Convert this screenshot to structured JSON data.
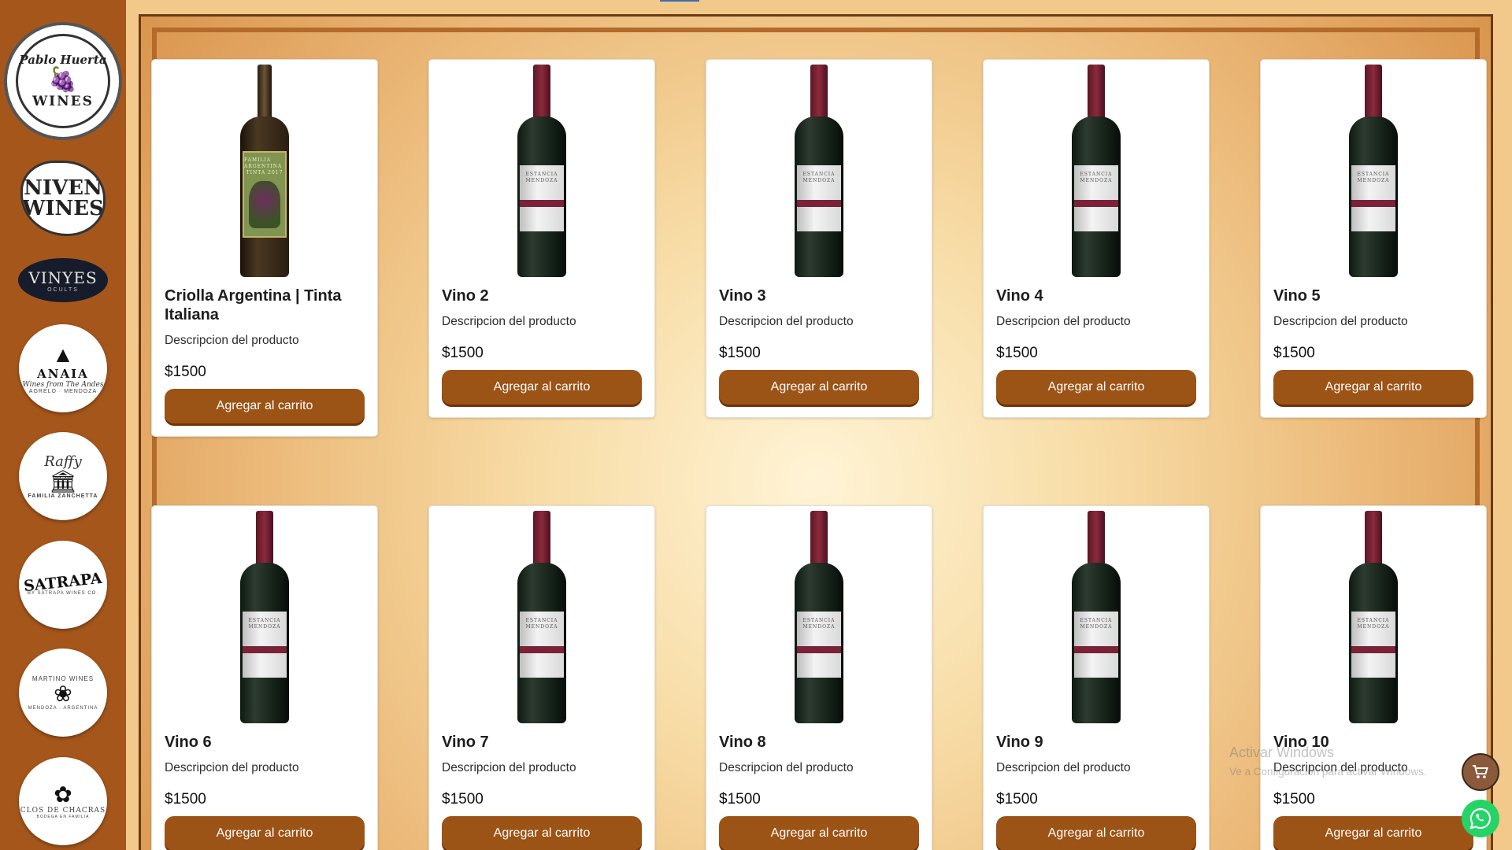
{
  "sidebar": {
    "brands": [
      {
        "name": "Pablo Huerta Wines",
        "top": "Pablo Huerta",
        "bottom": "WINES"
      },
      {
        "name": "Niven Wines",
        "lines": [
          "NIVEN",
          "WINES"
        ]
      },
      {
        "name": "Vinyes Ocults",
        "big": "VINYES",
        "small": "OCULTS"
      },
      {
        "name": "Anaia",
        "title": "ANAIA",
        "sub": "Wines from The Andes",
        "tiny": "AGRELO · MENDOZA"
      },
      {
        "name": "Familia Zanchetta",
        "sub": "Raffy",
        "tiny": "FAMILIA ZANCHETTA"
      },
      {
        "name": "Satrapa",
        "title": "SATRAPA",
        "tiny": "BY SATRAPA WINES CO."
      },
      {
        "name": "Martino Wines",
        "title": "MARTINO WINES",
        "tiny": "MENDOZA · ARGENTINA"
      },
      {
        "name": "Clos de Chacras",
        "title": "CLOS DE CHACRAS",
        "tiny": "BODEGA EN FAMILIA"
      }
    ]
  },
  "products": [
    {
      "name": "Criolla Argentina | Tinta Italiana",
      "description": "Descripcion del producto",
      "price": "$1500",
      "button": "Agregar al carrito",
      "bottle": "green",
      "label_text": [
        "FAMILIA ARGENTINA",
        "TINTA 2017"
      ]
    },
    {
      "name": "Vino 2",
      "description": "Descripcion del producto",
      "price": "$1500",
      "button": "Agregar al carrito",
      "bottle": "red",
      "label_text": [
        "ESTANCIA",
        "MENDOZA"
      ]
    },
    {
      "name": "Vino 3",
      "description": "Descripcion del producto",
      "price": "$1500",
      "button": "Agregar al carrito",
      "bottle": "red",
      "label_text": [
        "ESTANCIA",
        "MENDOZA"
      ]
    },
    {
      "name": "Vino 4",
      "description": "Descripcion del producto",
      "price": "$1500",
      "button": "Agregar al carrito",
      "bottle": "red",
      "label_text": [
        "ESTANCIA",
        "MENDOZA"
      ]
    },
    {
      "name": "Vino 5",
      "description": "Descripcion del producto",
      "price": "$1500",
      "button": "Agregar al carrito",
      "bottle": "red",
      "label_text": [
        "ESTANCIA",
        "MENDOZA"
      ]
    },
    {
      "name": "Vino 6",
      "description": "Descripcion del producto",
      "price": "$1500",
      "button": "Agregar al carrito",
      "bottle": "red",
      "label_text": [
        "ESTANCIA",
        "MENDOZA"
      ]
    },
    {
      "name": "Vino 7",
      "description": "Descripcion del producto",
      "price": "$1500",
      "button": "Agregar al carrito",
      "bottle": "red",
      "label_text": [
        "ESTANCIA",
        "MENDOZA"
      ]
    },
    {
      "name": "Vino 8",
      "description": "Descripcion del producto",
      "price": "$1500",
      "button": "Agregar al carrito",
      "bottle": "red",
      "label_text": [
        "ESTANCIA",
        "MENDOZA"
      ]
    },
    {
      "name": "Vino 9",
      "description": "Descripcion del producto",
      "price": "$1500",
      "button": "Agregar al carrito",
      "bottle": "red",
      "label_text": [
        "ESTANCIA",
        "MENDOZA"
      ]
    },
    {
      "name": "Vino 10",
      "description": "Descripcion del producto",
      "price": "$1500",
      "button": "Agregar al carrito",
      "bottle": "red",
      "label_text": [
        "ESTANCIA",
        "MENDOZA"
      ]
    }
  ],
  "watermark": {
    "line1": "Activar Windows",
    "line2": "Ve a Configuración para activar Windows."
  },
  "floating": {
    "cart_icon": "cart-icon",
    "whatsapp_icon": "whatsapp-icon"
  },
  "colors": {
    "sidebar": "#a5561b",
    "button": "#9c5316",
    "whatsapp": "#25d366"
  }
}
